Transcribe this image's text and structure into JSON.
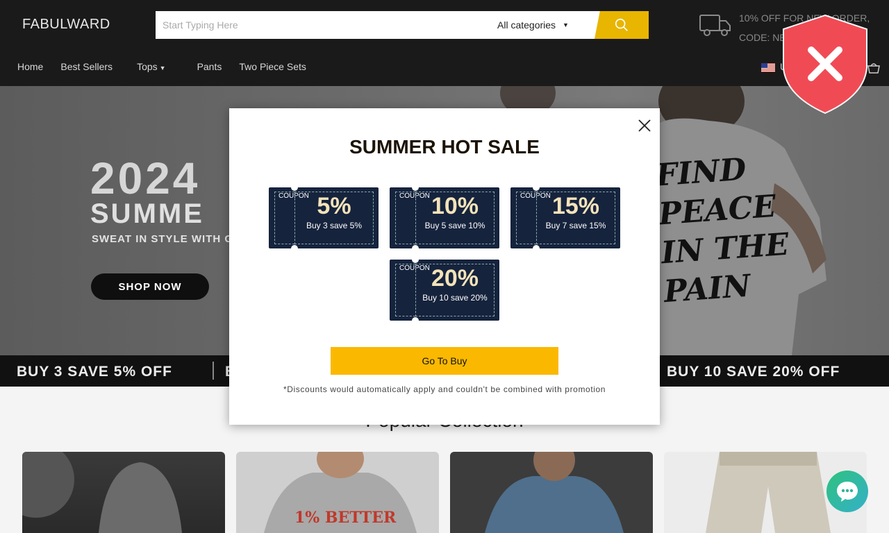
{
  "header": {
    "logo": "FABULWARD",
    "search_placeholder": "Start Typing Here",
    "category": "All categories",
    "promo_line1": "10% OFF FOR NEW ORDER,",
    "promo_line2": "CODE: NE",
    "language": "U"
  },
  "nav": {
    "items": [
      {
        "label": "Home"
      },
      {
        "label": "Best Sellers"
      },
      {
        "label": "Tops"
      },
      {
        "label": "Pants"
      },
      {
        "label": "Two Piece Sets"
      }
    ]
  },
  "hero": {
    "year": "2024",
    "title": "SUMME",
    "subtitle": "SWEAT IN STYLE WITH G",
    "button": "SHOP NOW",
    "shirt_text": "FIND\nPEACE\nIN THE\nPAIN"
  },
  "ticker": {
    "left": "BUY 3 SAVE 5% OFF",
    "middle": "B",
    "right": "BUY 10 SAVE 20% OFF"
  },
  "section": {
    "popular_title": "Popular Collection"
  },
  "modal": {
    "title": "SUMMER HOT SALE",
    "coupon_word": "COUPON",
    "coupons": [
      {
        "percent": "5%",
        "desc": "Buy 3 save 5%"
      },
      {
        "percent": "10%",
        "desc": "Buy 5 save 10%"
      },
      {
        "percent": "15%",
        "desc": "Buy 7 save 15%"
      },
      {
        "percent": "20%",
        "desc": "Buy 10 save 20%"
      }
    ],
    "button": "Go To Buy",
    "note": "*Discounts would automatically apply and couldn't be combined with promotion"
  },
  "cards": {
    "card2_text": "1% BETTER"
  },
  "colors": {
    "header_bg": "#1a1a1a",
    "accent_yellow": "#fbb800",
    "coupon_bg": "#16233d",
    "shield_red": "#f04b55",
    "chat_green": "#2ec27e"
  }
}
